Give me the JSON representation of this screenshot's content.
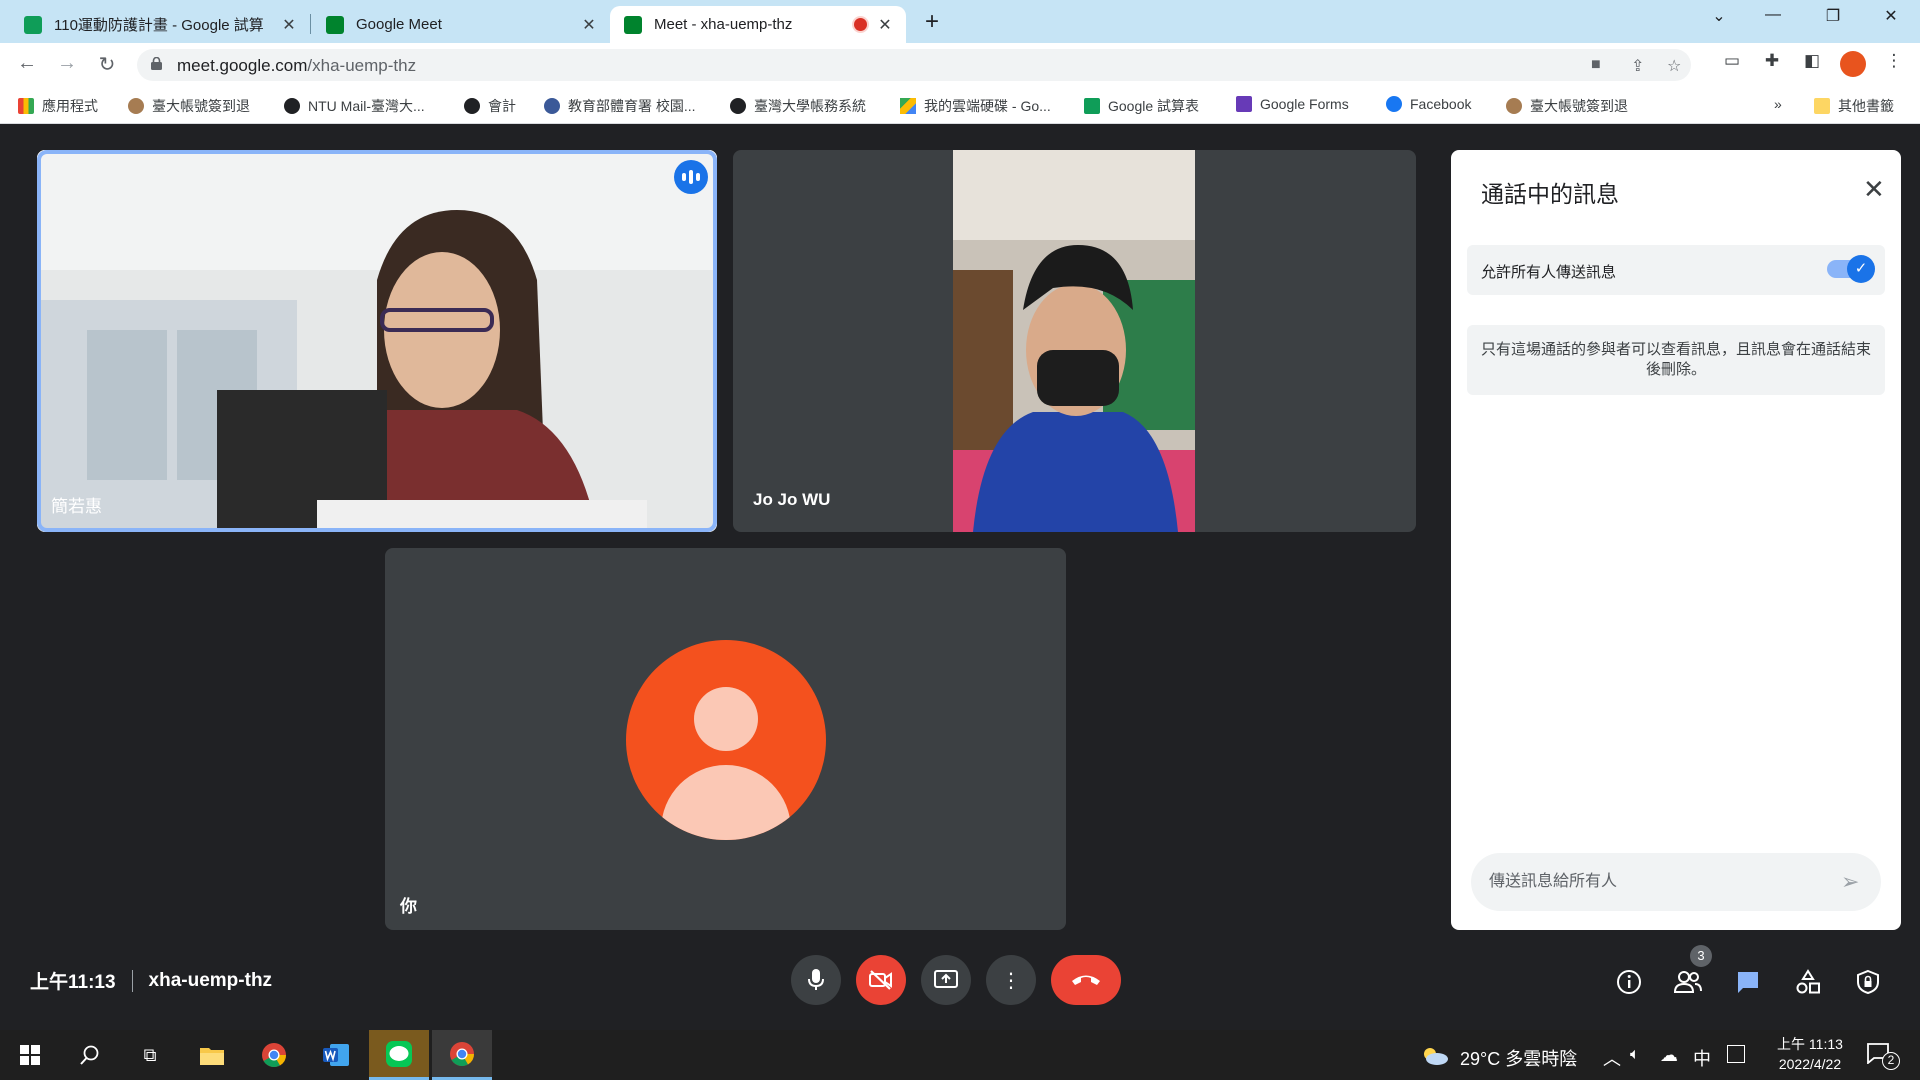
{
  "browser": {
    "tabs": [
      {
        "title": "110運動防護計畫 - Google 試算",
        "favicon_color": "#0f9d58"
      },
      {
        "title": "Google Meet",
        "favicon_color": "#00832d"
      },
      {
        "title": "Meet - xha-uemp-thz",
        "favicon_color": "#00832d"
      }
    ],
    "url_host": "meet.google.com",
    "url_path": "/xha-uemp-thz",
    "bookmarks": [
      {
        "label": "應用程式",
        "color": "#ea4335"
      },
      {
        "label": "臺大帳號簽到退",
        "color": "#a67c52"
      },
      {
        "label": "NTU Mail-臺灣大...",
        "color": "#202124"
      },
      {
        "label": "會計",
        "color": "#202124"
      },
      {
        "label": "教育部體育署 校園...",
        "color": "#3b5998"
      },
      {
        "label": "臺灣大學帳務系統",
        "color": "#202124"
      },
      {
        "label": "我的雲端硬碟 - Go...",
        "color": "#fbbc04"
      },
      {
        "label": "Google 試算表",
        "color": "#0f9d58"
      },
      {
        "label": "Google Forms",
        "color": "#673ab7"
      },
      {
        "label": "Facebook",
        "color": "#1877f2"
      },
      {
        "label": "臺大帳號簽到退",
        "color": "#a67c52"
      }
    ],
    "overflow": "»",
    "other_bookmarks": "其他書籤"
  },
  "meet": {
    "participants": [
      {
        "name": "簡若惠"
      },
      {
        "name": "Jo Jo WU"
      },
      {
        "name": "你"
      }
    ],
    "time": "上午11:13",
    "meeting_code": "xha-uemp-thz",
    "participant_count": "3"
  },
  "chat": {
    "title": "通話中的訊息",
    "allow_label": "允許所有人傳送訊息",
    "notice": "只有這場通話的參與者可以查看訊息，且訊息會在通話結束後刪除。",
    "placeholder": "傳送訊息給所有人"
  },
  "taskbar": {
    "weather": "29°C  多雲時陰",
    "ime": "中",
    "time": "上午 11:13",
    "date": "2022/4/22",
    "notifications": "2"
  },
  "colors": {
    "accent": "#1a73e8",
    "end_call": "#ea4335",
    "avatar": "#f4511e"
  }
}
